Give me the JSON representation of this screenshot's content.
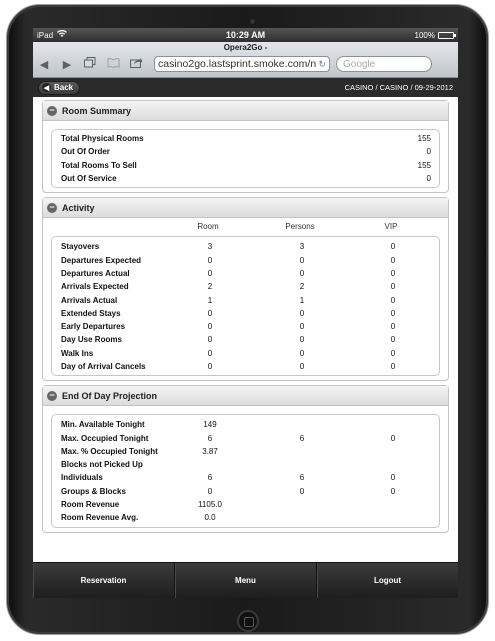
{
  "status_bar": {
    "carrier": "iPad",
    "time": "10:29 AM",
    "battery": "100%",
    "battery_level": 1.0
  },
  "browser": {
    "page_title": "Opera2Go -",
    "url": "casino2go.lastsprint.smoke.com/n",
    "search_placeholder": "Google"
  },
  "header": {
    "back_label": "Back",
    "breadcrumb": "CASINO / CASINO / 09-29-2012"
  },
  "room_summary": {
    "title": "Room Summary",
    "rows": [
      {
        "label": "Total Physical Rooms",
        "value": "155"
      },
      {
        "label": "Out Of Order",
        "value": "0"
      },
      {
        "label": "Total Rooms To Sell",
        "value": "155"
      },
      {
        "label": "Out Of Service",
        "value": "0"
      }
    ]
  },
  "activity": {
    "title": "Activity",
    "columns": [
      "Room",
      "Persons",
      "VIP"
    ],
    "rows": [
      {
        "label": "Stayovers",
        "values": [
          "3",
          "3",
          "0"
        ]
      },
      {
        "label": "Departures Expected",
        "values": [
          "0",
          "0",
          "0"
        ]
      },
      {
        "label": "Departures Actual",
        "values": [
          "0",
          "0",
          "0"
        ]
      },
      {
        "label": "Arrivals Expected",
        "values": [
          "2",
          "2",
          "0"
        ]
      },
      {
        "label": "Arrivals Actual",
        "values": [
          "1",
          "1",
          "0"
        ]
      },
      {
        "label": "Extended Stays",
        "values": [
          "0",
          "0",
          "0"
        ]
      },
      {
        "label": "Early Departures",
        "values": [
          "0",
          "0",
          "0"
        ]
      },
      {
        "label": "Day Use Rooms",
        "values": [
          "0",
          "0",
          "0"
        ]
      },
      {
        "label": "Walk Ins",
        "values": [
          "0",
          "0",
          "0"
        ]
      },
      {
        "label": "Day of Arrival Cancels",
        "values": [
          "0",
          "0",
          "0"
        ]
      }
    ]
  },
  "projection": {
    "title": "End Of Day Projection",
    "rows": [
      {
        "label": "Min. Available Tonight",
        "values": [
          "149",
          "",
          ""
        ]
      },
      {
        "label": "Max. Occupied Tonight",
        "values": [
          "6",
          "6",
          "0"
        ]
      },
      {
        "label": "Max. % Occupied Tonight",
        "values": [
          "3.87",
          "",
          ""
        ]
      },
      {
        "label": "Blocks not Picked Up",
        "values": [
          "",
          "",
          ""
        ]
      },
      {
        "label": "Individuals",
        "values": [
          "6",
          "6",
          "0"
        ]
      },
      {
        "label": "Groups & Blocks",
        "values": [
          "0",
          "0",
          "0"
        ]
      },
      {
        "label": "Room Revenue",
        "values": [
          "1105.0",
          "",
          ""
        ]
      },
      {
        "label": "Room Revenue Avg.",
        "values": [
          "0.0",
          "",
          ""
        ]
      }
    ]
  },
  "tabbar": {
    "reservation": "Reservation",
    "menu": "Menu",
    "logout": "Logout"
  }
}
